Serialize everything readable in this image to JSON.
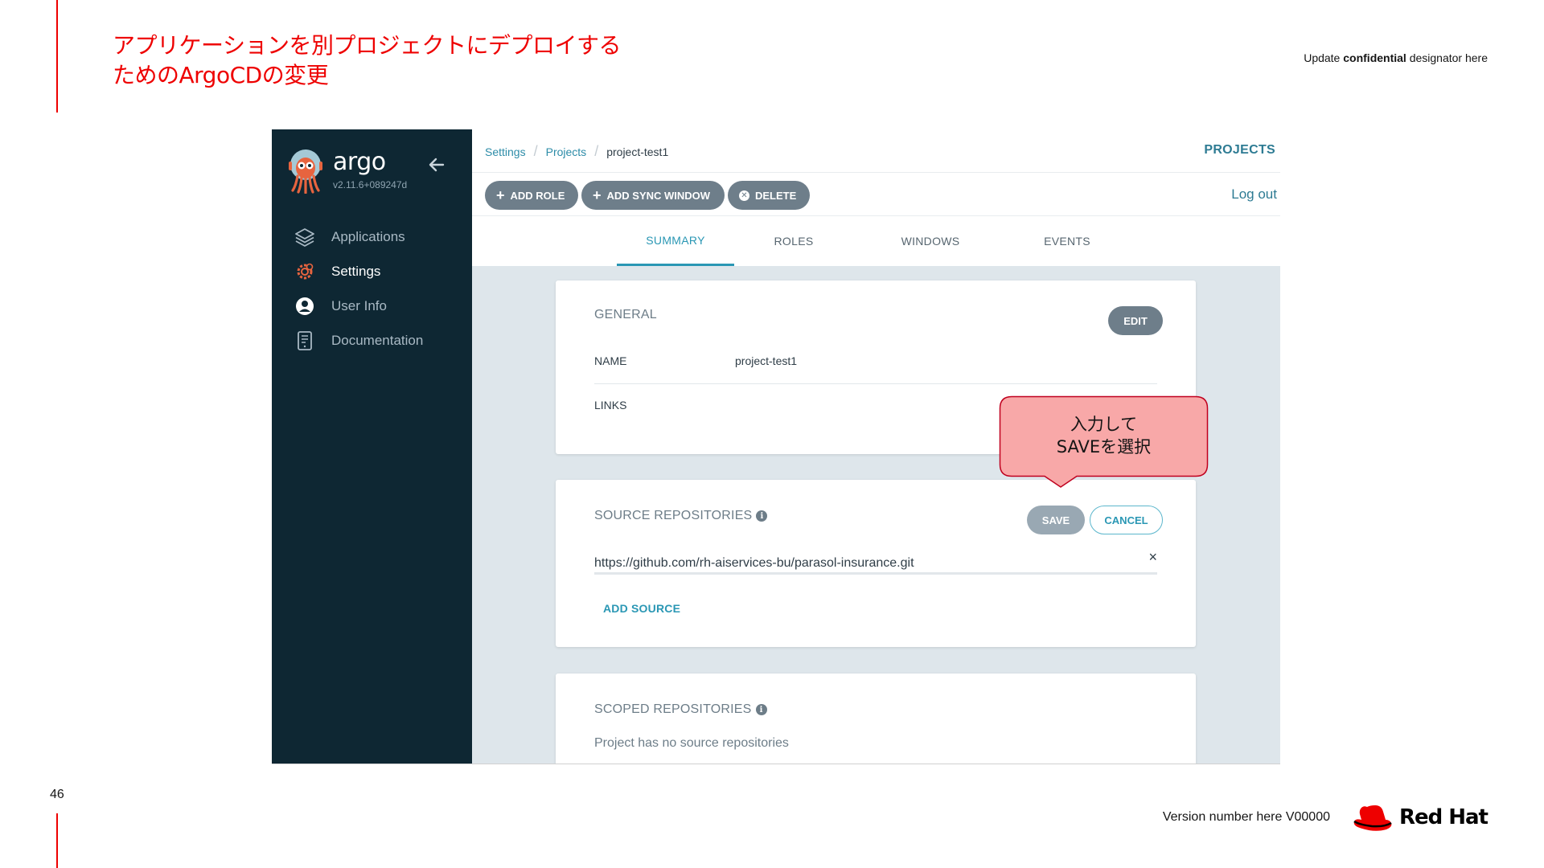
{
  "slide": {
    "title_line1": "アプリケーションを別プロジェクトにデプロイする",
    "title_line2": "ためのArgoCDの変更",
    "confidential_prefix": "Update ",
    "confidential_bold": "confidential",
    "confidential_suffix": " designator here",
    "page_number": "46",
    "version": "Version number here V00000",
    "logo_text": "Red Hat",
    "accent_color": "#ee0000"
  },
  "argo": {
    "brand_name": "argo",
    "version": "v2.11.6+089247d",
    "sidebar_items": [
      {
        "label": "Applications",
        "icon": "layers-icon"
      },
      {
        "label": "Settings",
        "icon": "gear-icon"
      },
      {
        "label": "User Info",
        "icon": "user-icon"
      },
      {
        "label": "Documentation",
        "icon": "book-icon"
      }
    ],
    "breadcrumbs": [
      "Settings",
      "Projects",
      "project-test1"
    ],
    "page_title": "PROJECTS",
    "toolbar": {
      "add_role": "ADD ROLE",
      "add_sync_window": "ADD SYNC WINDOW",
      "delete": "DELETE",
      "logout": "Log out"
    },
    "tabs": [
      "SUMMARY",
      "ROLES",
      "WINDOWS",
      "EVENTS"
    ],
    "active_tab": "SUMMARY",
    "general": {
      "heading": "GENERAL",
      "edit": "EDIT",
      "name_label": "NAME",
      "name_value": "project-test1",
      "links_label": "LINKS"
    },
    "source_repos": {
      "heading": "SOURCE REPOSITORIES",
      "save": "SAVE",
      "cancel": "CANCEL",
      "repo_value": "https://github.com/rh-aiservices-bu/parasol-insurance.git",
      "remove": "×",
      "add_source": "ADD SOURCE"
    },
    "scoped_repos": {
      "heading": "SCOPED REPOSITORIES",
      "empty": "Project has no source repositories"
    },
    "info_glyph": "i",
    "colors": {
      "sidebar": "#0e2733",
      "accent": "#2a97b4",
      "button": "#6e7e8a"
    }
  },
  "callout": {
    "line1": "入力して",
    "line2": "SAVEを選択",
    "fill": "#f8a8a8",
    "border": "#c0001e"
  }
}
